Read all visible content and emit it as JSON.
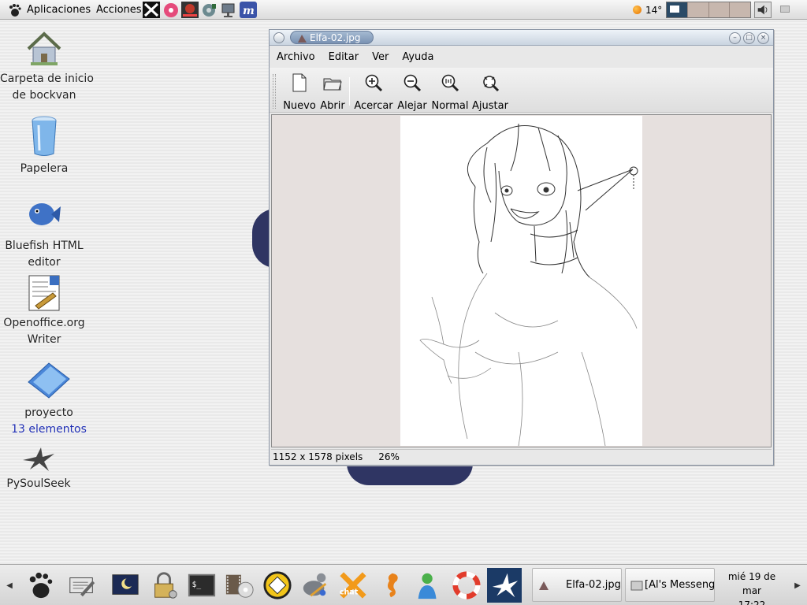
{
  "top_panel": {
    "menus": [
      {
        "label": "Aplicaciones"
      },
      {
        "label": "Acciones"
      }
    ],
    "launchers": [
      "crossover-icon",
      "cd-player-icon",
      "multimedia-icon",
      "disk-icon",
      "network-monitor-icon",
      "mozilla-icon"
    ],
    "weather": {
      "temperature": "14°"
    },
    "workspaces": 4
  },
  "desktop": {
    "icons": [
      {
        "lines": [
          "Carpeta de inicio",
          "de bockvan"
        ],
        "icon": "home-folder-icon"
      },
      {
        "lines": [
          "Papelera"
        ],
        "icon": "trash-icon"
      },
      {
        "lines": [
          "Bluefish HTML",
          "editor"
        ],
        "icon": "bluefish-icon"
      },
      {
        "lines": [
          "Openoffice.org",
          "Writer"
        ],
        "icon": "writer-icon"
      },
      {
        "lines": [
          "proyecto",
          "13 elementos"
        ],
        "icon": "folder-icon"
      },
      {
        "lines": [
          "PySoulSeek"
        ],
        "icon": "pysoulseek-icon"
      }
    ]
  },
  "window": {
    "title": "Elfa-02.jpg",
    "menus": [
      {
        "label": "Archivo"
      },
      {
        "label": "Editar"
      },
      {
        "label": "Ver"
      },
      {
        "label": "Ayuda"
      }
    ],
    "toolbar": [
      {
        "label": "Nuevo",
        "icon": "new-document-icon"
      },
      {
        "label": "Abrir",
        "icon": "open-folder-icon"
      },
      {
        "label": "Acercar",
        "icon": "zoom-in-icon"
      },
      {
        "label": "Alejar",
        "icon": "zoom-out-icon"
      },
      {
        "label": "Normal",
        "icon": "zoom-normal-icon"
      },
      {
        "label": "Ajustar",
        "icon": "zoom-fit-icon"
      }
    ],
    "status": {
      "dimensions": "1152 x 1578 pixels",
      "zoom": "26%"
    }
  },
  "bottom_panel": {
    "launchers": [
      "gnome-menu-icon",
      "text-editor-icon",
      "screensaver-icon",
      "lock-icon",
      "terminal-icon",
      "video-icon",
      "xchat-icon",
      "gimp-icon",
      "xchat-x-icon",
      "seahorse-icon",
      "messenger-icon",
      "help-icon",
      "pysoulseek-icon"
    ],
    "tasks": [
      {
        "label": "Elfa-02.jpg",
        "icon": "image-viewer-icon"
      },
      {
        "label": "[Al's Messenger]",
        "icon": "messenger-window-icon"
      }
    ],
    "clock": {
      "date": "mié 19 de mar",
      "time": "17:22"
    }
  }
}
